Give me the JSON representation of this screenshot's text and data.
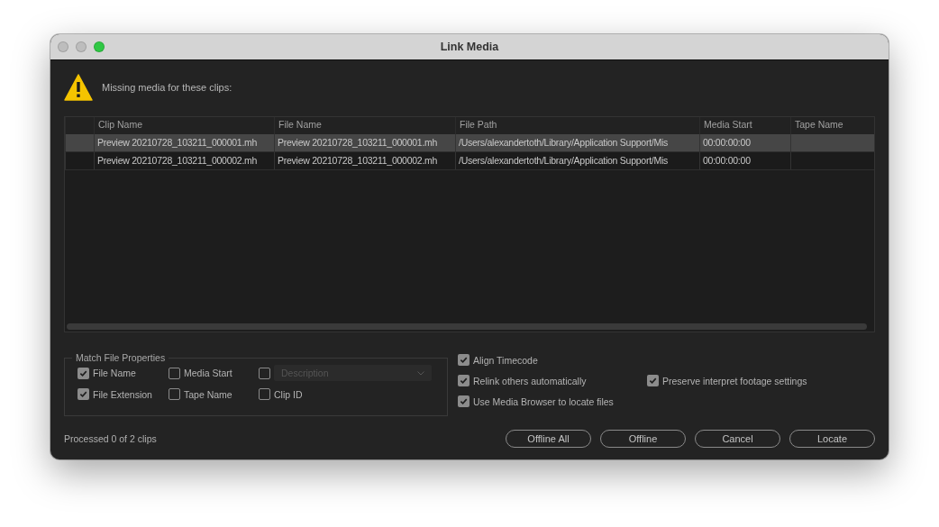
{
  "window": {
    "title": "Link Media"
  },
  "warning": {
    "message": "Missing media for these clips:"
  },
  "table": {
    "columns": [
      "Clip Name",
      "File Name",
      "File Path",
      "Media Start",
      "Tape Name"
    ],
    "rows": [
      {
        "selected": true,
        "cells": [
          "Preview 20210728_103211_000001.mh",
          "Preview 20210728_103211_000001.mh",
          "/Users/alexandertoth/Library/Application Support/Mis",
          "00:00:00:00"
        ]
      },
      {
        "selected": false,
        "cells": [
          "Preview 20210728_103211_000002.mh",
          "Preview 20210728_103211_000002.mh",
          "/Users/alexandertoth/Library/Application Support/Mis",
          "00:00:00:00"
        ]
      }
    ]
  },
  "match_file_properties": {
    "title": "Match File Properties",
    "options": [
      {
        "kind": "checkbox",
        "label": "File Name",
        "checked": true
      },
      {
        "kind": "checkbox",
        "label": "Media Start",
        "checked": false
      },
      {
        "kind": "dropdown",
        "value": "Description",
        "checked": false,
        "disabled": true
      },
      {
        "kind": "checkbox",
        "label": "File Extension",
        "checked": true
      },
      {
        "kind": "checkbox",
        "label": "Tape Name",
        "checked": false
      },
      {
        "kind": "checkbox",
        "label": "Clip ID",
        "checked": false
      }
    ]
  },
  "options": [
    [
      {
        "label": "Align Timecode",
        "checked": true
      }
    ],
    [
      {
        "label": "Relink others automatically",
        "checked": true
      },
      {
        "label": "Preserve interpret footage settings",
        "checked": true
      }
    ],
    [
      {
        "label": "Use Media Browser to locate files",
        "checked": true
      }
    ]
  ],
  "status": "Processed 0 of 2 clips",
  "buttons": [
    "Offline All",
    "Offline",
    "Cancel",
    "Locate"
  ]
}
